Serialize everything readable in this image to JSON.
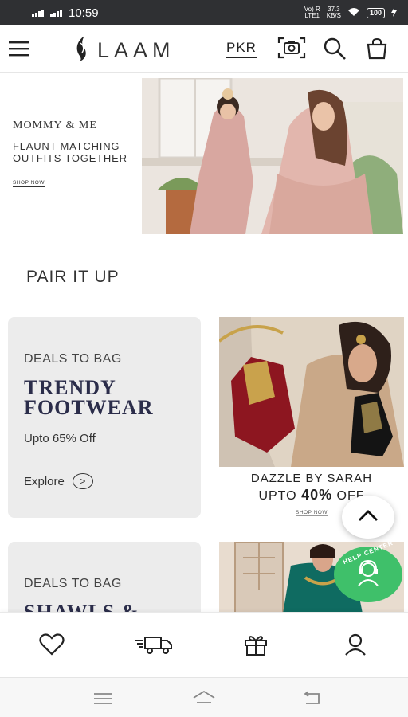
{
  "status_bar": {
    "time": "10:59",
    "network_top": "Vo) R",
    "network_bottom": "LTE1",
    "speed_top": "37.3",
    "speed_bottom": "KB/S",
    "battery": "100"
  },
  "header": {
    "logo_text": "LAAM",
    "currency": "PKR",
    "icons": [
      "menu-icon",
      "laam-leaf-icon",
      "camera-search-icon",
      "search-icon",
      "bag-icon"
    ]
  },
  "banner": {
    "title": "MOMMY & ME",
    "subtitle_line1": "FLAUNT MATCHING",
    "subtitle_line2": "OUTFITS TOGETHER",
    "link": "SHOP NOW"
  },
  "section": {
    "title": "PAIR IT UP"
  },
  "deal_card_1": {
    "kicker": "DEALS TO BAG",
    "title_line1": "TRENDY",
    "title_line2": "FOOTWEAR",
    "discount": "Upto 65% Off",
    "explore": "Explore",
    "explore_arrow": ">"
  },
  "promo_1": {
    "brand": "DAZZLE BY SARAH",
    "offer_prefix": "UPTO",
    "offer_value": "40%",
    "offer_suffix": "OFF",
    "link": "SHOP NOW"
  },
  "deal_card_2": {
    "kicker": "DEALS TO BAG",
    "title_line1": "SHAWLS &"
  },
  "help_center": {
    "label": "HELP CENTER"
  },
  "bottom_nav": {
    "items": [
      "wishlist-icon",
      "delivery-truck-icon",
      "gift-icon",
      "profile-icon"
    ]
  },
  "system_nav": {
    "items": [
      "recent-apps-icon",
      "home-icon",
      "back-icon"
    ]
  },
  "colors": {
    "status_bar_bg": "#2f3033",
    "card_bg": "#ececec",
    "deal_title": "#2b2d4a",
    "help_center": "#3fc06a"
  }
}
